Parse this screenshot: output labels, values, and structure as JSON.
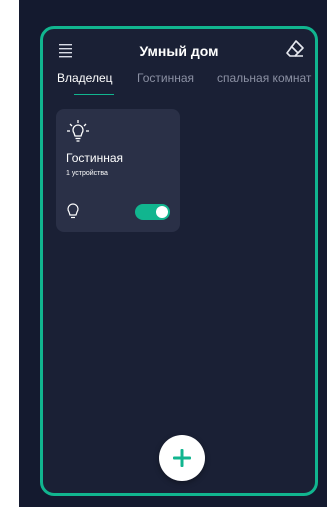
{
  "header": {
    "title": "Умный дом"
  },
  "tabs": [
    {
      "label": "Владелец",
      "active": true
    },
    {
      "label": "Гостинная",
      "active": false
    },
    {
      "label": "спальная комнат",
      "active": false
    }
  ],
  "room_card": {
    "name": "Гостинная",
    "device_count": "1 устройства",
    "toggle_on": true
  },
  "icons": {
    "menu": "menu-icon",
    "edit": "eraser-icon",
    "bulb": "lightbulb-icon",
    "add": "plus-icon"
  },
  "colors": {
    "accent": "#11b58f",
    "background": "#1a2035",
    "card": "#2a3047"
  }
}
